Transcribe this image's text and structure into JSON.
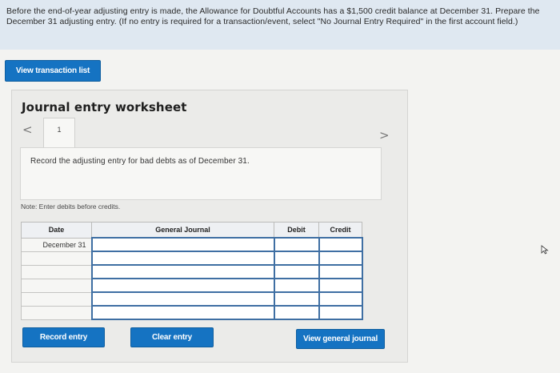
{
  "question": {
    "text": "Before the end-of-year adjusting entry is made, the Allowance for Doubtful Accounts has a $1,500 credit balance at December 31. Prepare the December 31 adjusting entry. (If no entry is required for a transaction/event, select \"No Journal Entry Required\" in the first account field.)"
  },
  "buttons": {
    "view_transactions": "View transaction list",
    "record_entry": "Record entry",
    "clear_entry": "Clear entry",
    "view_general_journal": "View general journal"
  },
  "worksheet": {
    "title": "Journal entry worksheet",
    "prev": "<",
    "next": ">",
    "tab_label": "1",
    "instruction": "Record the adjusting entry for bad debts as of December 31.",
    "note": "Note: Enter debits before credits."
  },
  "table": {
    "headers": {
      "date": "Date",
      "general_journal": "General Journal",
      "debit": "Debit",
      "credit": "Credit"
    },
    "rows": [
      {
        "date": "December 31"
      },
      {
        "date": ""
      },
      {
        "date": ""
      },
      {
        "date": ""
      },
      {
        "date": ""
      },
      {
        "date": ""
      }
    ]
  },
  "colors": {
    "accent": "#1573c2",
    "question_bg": "#dfe8f1",
    "input_border": "#3f6fa3"
  }
}
